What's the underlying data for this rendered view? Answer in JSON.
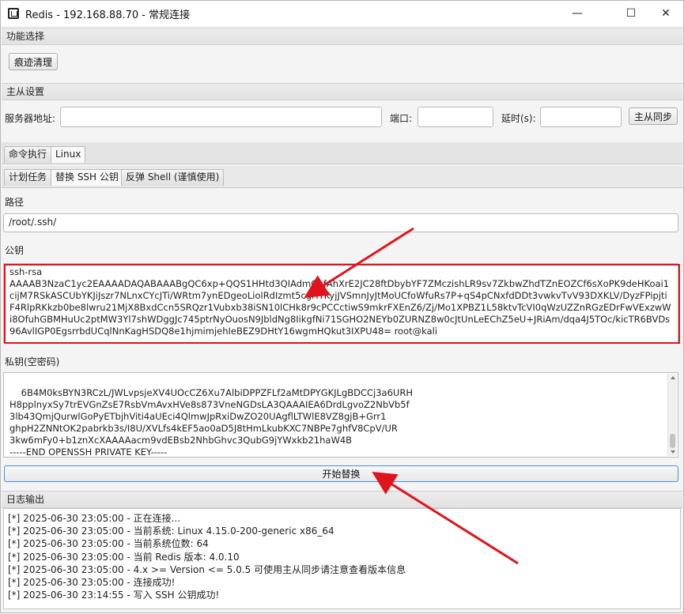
{
  "window": {
    "title": "Redis - 192.168.88.70 - 常规连接",
    "controls": {
      "minimize": "—",
      "maximize": "☐",
      "close": "✕"
    }
  },
  "functions": {
    "section_title": "功能选择",
    "clean_button": "痕迹清理"
  },
  "master_slave": {
    "section_title": "主从设置",
    "server_label": "服务器地址:",
    "server_value": "",
    "port_label": "端口:",
    "port_value": "",
    "delay_label": "延时(s):",
    "delay_value": "",
    "sync_button": "主从同步"
  },
  "top_tabs": [
    {
      "label": "命令执行",
      "active": false
    },
    {
      "label": "Linux",
      "active": true
    }
  ],
  "sub_tabs": [
    {
      "label": "计划任务",
      "active": false
    },
    {
      "label": "替换 SSH 公钥",
      "active": true
    },
    {
      "label": "反弹 Shell (谨慎使用)",
      "active": false
    }
  ],
  "ssh": {
    "path_label": "路径",
    "path_value": "/root/.ssh/",
    "pubkey_label": "公钥",
    "pubkey_value": "ssh-rsa\nAAAAB3NzaC1yc2EAAAADAQABAAABgQC6xp+QQS1HHtd3QIAdmGkfAhXrE2JC28ftDbybYF7ZMczishLR9sv7ZkbwZhdTZnEOZCf6sXoPK9deHKoai1cijM7RSkASCUbYKJiJszr7NLnxCYcJTi/WRtm7ynEDgeoLiolRdIzmt5cgHYKyjJVSmnJyJtMoUCfoWfuRs7P+qS4pCNxfdDDt3vwkvTvV93DXKLV/DyzFPipjtiF4RlpRKkzb0be8lwru21MjX8BxdCcn5SRQzr1Vubxb38iSN10lCHk8r9cPCCctiwS9mkrFXEnZ6/Zj/Mo1XPBZ1L58ktvTcVI0qWzUZZnRGzEDrFwVExzwWi8OfuhGBMHuUc2ptMW3Yl7shWDggJc745ptrNyOuosN9JbldNg8IikgfNi71SGHO2NEYb0ZURNZ8w0cJtUnLeEChZ5eU+JRiAm/dqa4J5TOc/kicTR6BVDs96AvlIGP0EgsrrbdUCqlNnKagHSDQ8e1hjmimjehIeBEZ9DHtY16wgmHQkut3IXPU48= root@kali",
    "privkey_label": "私钥(空密码)",
    "privkey_value": "6B4M0ksBYN3RCzL/JWLvpsjeXV4UOcCZ6Xu7AlbiDPPZFLf2aMtDPYGKJLgBDCCj3a6URH\nH8pplnyxSy7trEVGnZsE7RsbVmAvxHVe8s873VneNGDsLA3QAAAIEA6DrdLgvoZ2NbVb5f\n3lb43QmjQurwlGoPyETbjhViti4aUEci4QlmwJpRxiDwZO20UAgflLTWlE8VZ8gjB+Grr1\nghpH2ZNNtOK2pabrkb3s/I8U/XVLfs4kEF5ao0aD5J8tHmLkubKXC7NBPe7ghfV8CpV/UR\n3kw6mFy0+b1znXcXAAAAacm9vdEBsb2NhbGhvc3QubG9jYWxkb21haW4B\n-----END OPENSSH PRIVATE KEY-----",
    "start_button": "开始替换"
  },
  "log": {
    "section_title": "日志输出",
    "lines": [
      "[*] 2025-06-30 23:05:00 - 正在连接...",
      "[*] 2025-06-30 23:05:00 - 当前系统: Linux 4.15.0-200-generic x86_64",
      "[*] 2025-06-30 23:05:00 - 当前系统位数: 64",
      "[*] 2025-06-30 23:05:00 - 当前 Redis 版本: 4.0.10",
      "[*] 2025-06-30 23:05:00 - 4.x >= Version <= 5.0.5 可使用主从同步请注意查看版本信息",
      "[*] 2025-06-30 23:05:00 - 连接成功!",
      "[*] 2025-06-30 23:14:55 - 写入 SSH 公钥成功!"
    ]
  },
  "colors": {
    "annotation_red": "#e0141c",
    "primary_button_border": "#4a90d9"
  }
}
